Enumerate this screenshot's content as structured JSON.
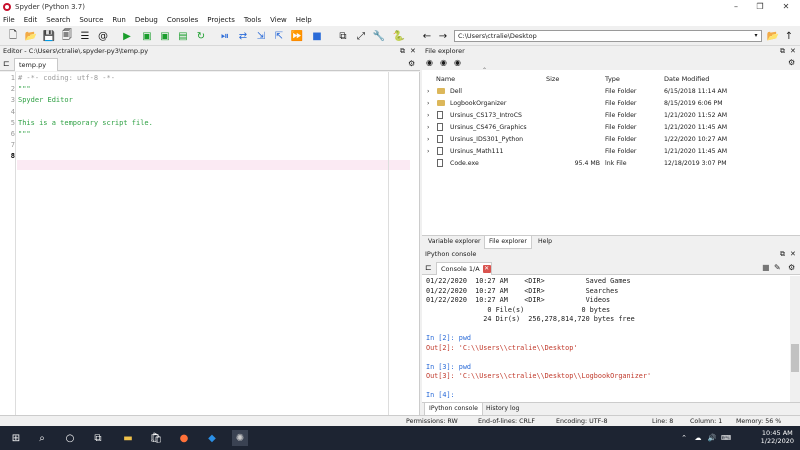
{
  "window": {
    "title": "Spyder (Python 3.7)"
  },
  "menu": [
    "File",
    "Edit",
    "Search",
    "Source",
    "Run",
    "Debug",
    "Consoles",
    "Projects",
    "Tools",
    "View",
    "Help"
  ],
  "toolbar": {
    "path": "C:\\Users\\ctralie\\Desktop",
    "colors": {
      "run": "#1a9e2c",
      "debug": "#2a6bd8"
    }
  },
  "editor": {
    "header": "Editor - C:\\Users\\ctralie\\.spyder-py3\\temp.py",
    "tab": "temp.py",
    "lines": [
      {
        "n": "1",
        "text": "# -*- coding: utf-8 -*-",
        "color": "#9a9a9a"
      },
      {
        "n": "2",
        "text": "\"\"\"",
        "color": "#2ea043"
      },
      {
        "n": "3",
        "text": "Spyder Editor",
        "color": "#2ea043"
      },
      {
        "n": "4",
        "text": "",
        "color": "#2ea043"
      },
      {
        "n": "5",
        "text": "This is a temporary script file.",
        "color": "#2ea043"
      },
      {
        "n": "6",
        "text": "\"\"\"",
        "color": "#2ea043"
      },
      {
        "n": "7",
        "text": "",
        "color": "#333"
      },
      {
        "n": "8",
        "text": "",
        "color": "#333"
      }
    ]
  },
  "file_explorer": {
    "header": "File explorer",
    "columns": {
      "name": "Name",
      "size": "Size",
      "type": "Type",
      "date": "Date Modified"
    },
    "rows": [
      {
        "name": "Dell",
        "size": "",
        "type": "File Folder",
        "date": "6/15/2018 11:14 AM",
        "icon": "folder"
      },
      {
        "name": "LogbookOrganizer",
        "size": "",
        "type": "File Folder",
        "date": "8/15/2019 6:06 PM",
        "icon": "folder"
      },
      {
        "name": "Ursinus_CS173_IntroCS",
        "size": "",
        "type": "File Folder",
        "date": "1/21/2020 11:52 AM",
        "icon": "file"
      },
      {
        "name": "Ursinus_CS476_Graphics",
        "size": "",
        "type": "File Folder",
        "date": "1/21/2020 11:45 AM",
        "icon": "file"
      },
      {
        "name": "Ursinus_IDS301_Python",
        "size": "",
        "type": "File Folder",
        "date": "1/22/2020 10:27 AM",
        "icon": "file"
      },
      {
        "name": "Ursinus_Math111",
        "size": "",
        "type": "File Folder",
        "date": "1/21/2020 11:45 AM",
        "icon": "file"
      },
      {
        "name": "Code.exe",
        "size": "95.4 MB",
        "type": "lnk File",
        "date": "12/18/2019 3:07 PM",
        "icon": "file"
      }
    ],
    "tabs": [
      "Variable explorer",
      "File explorer",
      "Help"
    ]
  },
  "console": {
    "header": "IPython console",
    "tab": "Console 1/A",
    "lines": [
      {
        "t": "01/22/2020  10:27 AM    <DIR>          Saved Games",
        "c": ""
      },
      {
        "t": "01/22/2020  10:27 AM    <DIR>          Searches",
        "c": ""
      },
      {
        "t": "01/22/2020  10:27 AM    <DIR>          Videos",
        "c": ""
      },
      {
        "t": "               0 File(s)              0 bytes",
        "c": ""
      },
      {
        "t": "              24 Dir(s)  256,278,814,720 bytes free",
        "c": ""
      },
      {
        "t": "",
        "c": ""
      },
      {
        "t": "In [2]: pwd",
        "c": "in"
      },
      {
        "t": "Out[2]: 'C:\\\\Users\\\\ctralie\\\\Desktop'",
        "c": "out"
      },
      {
        "t": "",
        "c": ""
      },
      {
        "t": "In [3]: pwd",
        "c": "in"
      },
      {
        "t": "Out[3]: 'C:\\\\Users\\\\ctralie\\\\Desktop\\\\LogbookOrganizer'",
        "c": "out"
      },
      {
        "t": "",
        "c": ""
      },
      {
        "t": "In [4]:",
        "c": "in"
      }
    ],
    "tabs": [
      "IPython console",
      "History log"
    ]
  },
  "status": {
    "permissions": "Permissions:  RW",
    "eol": "End-of-lines:  CRLF",
    "encoding": "Encoding:  UTF-8",
    "line": "Line:  8",
    "column": "Column:  1",
    "memory": "Memory:  56 %"
  },
  "taskbar": {
    "time": "10:45 AM",
    "date": "1/22/2020"
  }
}
